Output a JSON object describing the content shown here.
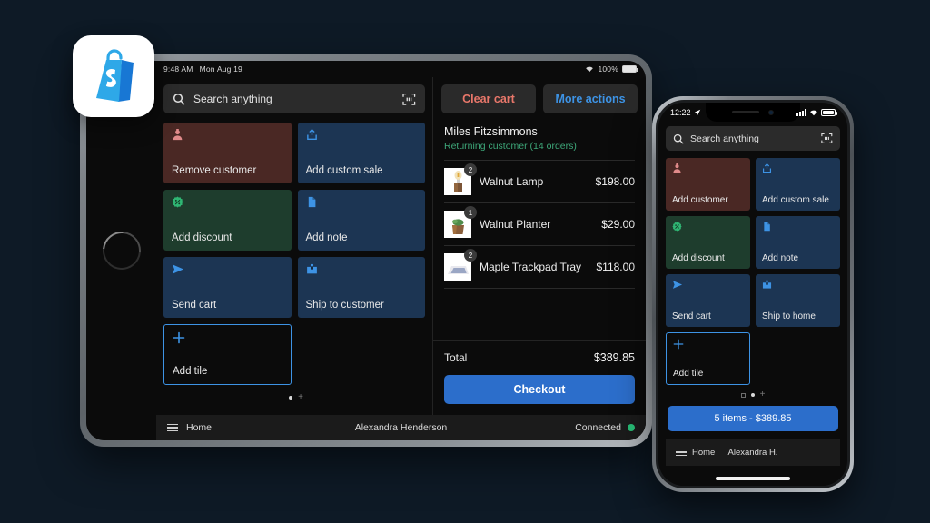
{
  "brand": {
    "logo_name": "shopify-bag-logo",
    "logo_color": "#2ea8e8",
    "logo_color_dark": "#1877d4"
  },
  "background_color": "#0e1a26",
  "tablet": {
    "status_bar": {
      "time": "9:48 AM",
      "date": "Mon Aug 19",
      "battery": "100%",
      "wifi_icon": "wifi-icon",
      "battery_icon": "battery-icon"
    },
    "search": {
      "placeholder": "Search anything",
      "icon": "search-icon",
      "scan_icon": "barcode-scan-icon"
    },
    "tiles": [
      {
        "label": "Remove customer",
        "icon": "customer-icon",
        "color": "red"
      },
      {
        "label": "Add custom sale",
        "icon": "upload-box-icon",
        "color": "blue"
      },
      {
        "label": "Add discount",
        "icon": "discount-tag-icon",
        "color": "green"
      },
      {
        "label": "Add note",
        "icon": "note-page-icon",
        "color": "blue"
      },
      {
        "label": "Send cart",
        "icon": "send-arrow-icon",
        "color": "blue"
      },
      {
        "label": "Ship to customer",
        "icon": "shipping-box-icon",
        "color": "blue"
      },
      {
        "label": "Add tile",
        "icon": "plus-icon",
        "color": "add"
      }
    ],
    "pagination": {
      "dots": 1,
      "add_page_icon": "plus-icon"
    },
    "cart": {
      "clear_label": "Clear cart",
      "more_label": "More actions",
      "customer_name": "Miles Fitzsimmons",
      "customer_status": "Returning customer (14 orders)",
      "items": [
        {
          "name": "Walnut Lamp",
          "price": "$198.00",
          "qty": "2",
          "thumb": "walnut-lamp-thumbnail"
        },
        {
          "name": "Walnut Planter",
          "price": "$29.00",
          "qty": "1",
          "thumb": "walnut-planter-thumbnail"
        },
        {
          "name": "Maple Trackpad Tray",
          "price": "$118.00",
          "qty": "2",
          "thumb": "maple-trackpad-tray-thumbnail"
        }
      ],
      "total_label": "Total",
      "total_value": "$389.85",
      "checkout_label": "Checkout",
      "checkout_color": "#2c6ecb"
    },
    "bottom_bar": {
      "home_label": "Home",
      "menu_icon": "hamburger-menu-icon",
      "staff_name": "Alexandra Henderson",
      "connection_label": "Connected",
      "connection_color": "#25b26f"
    }
  },
  "phone": {
    "status_bar": {
      "time": "12:22",
      "location_icon": "location-arrow-icon",
      "signal_icon": "cellular-bars-icon",
      "wifi_icon": "wifi-icon",
      "battery_icon": "battery-icon"
    },
    "search": {
      "placeholder": "Search anything",
      "icon": "search-icon",
      "scan_icon": "barcode-scan-icon"
    },
    "tiles": [
      {
        "label": "Add customer",
        "icon": "customer-icon",
        "color": "red"
      },
      {
        "label": "Add custom sale",
        "icon": "upload-box-icon",
        "color": "blue"
      },
      {
        "label": "Add discount",
        "icon": "discount-tag-icon",
        "color": "green"
      },
      {
        "label": "Add note",
        "icon": "note-page-icon",
        "color": "blue"
      },
      {
        "label": "Send cart",
        "icon": "send-arrow-icon",
        "color": "blue"
      },
      {
        "label": "Ship to home",
        "icon": "shipping-box-icon",
        "color": "blue"
      },
      {
        "label": "Add tile",
        "icon": "plus-icon",
        "color": "add"
      }
    ],
    "pagination": {
      "home_icon": "home-page-icon",
      "dots": 1,
      "add_page_icon": "plus-icon"
    },
    "cart_button_label": "5 items - $389.85",
    "cart_button_color": "#2c6ecb",
    "bottom_bar": {
      "home_label": "Home",
      "menu_icon": "hamburger-menu-icon",
      "staff_name": "Alexandra H.",
      "connection_color": "#25b26f"
    }
  }
}
